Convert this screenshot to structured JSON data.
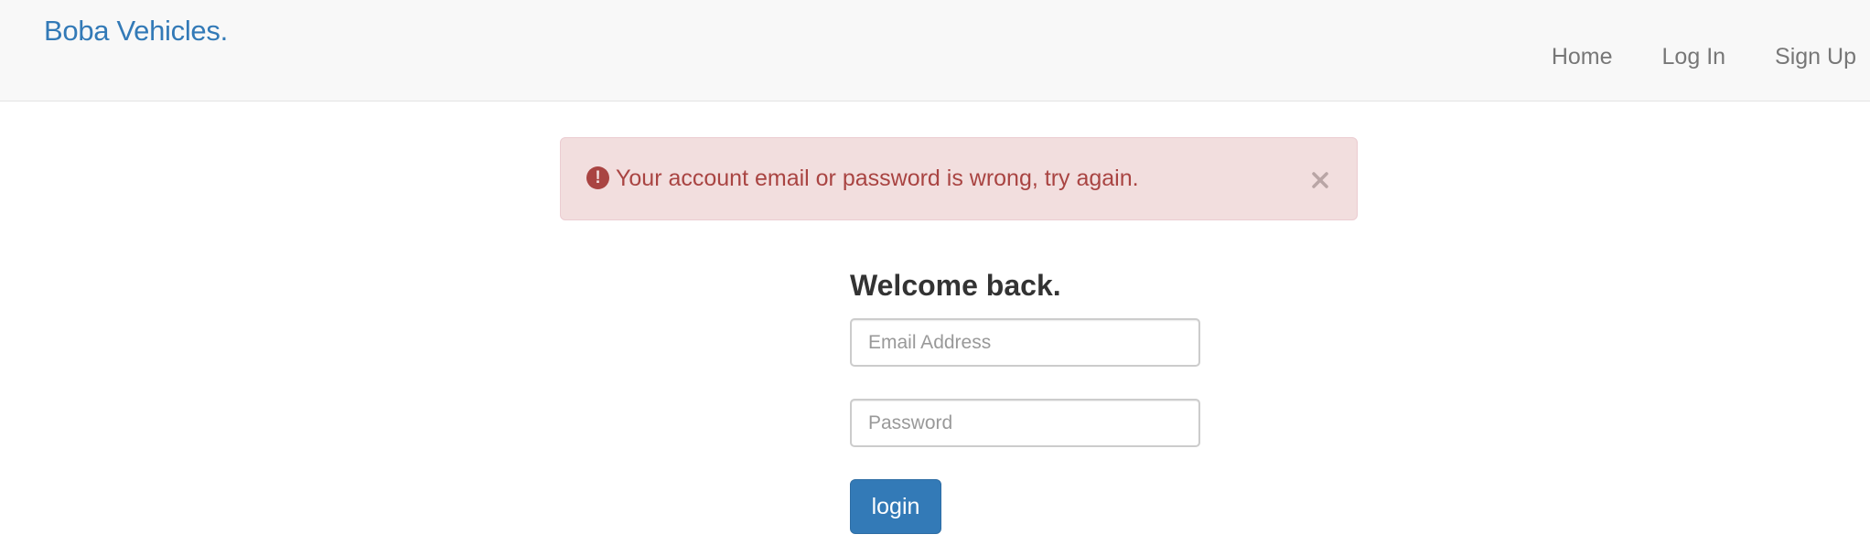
{
  "navbar": {
    "brand": "Boba Vehicles.",
    "links": [
      {
        "label": "Home"
      },
      {
        "label": "Log In"
      },
      {
        "label": "Sign Up"
      }
    ]
  },
  "alert": {
    "icon": "exclamation-circle-icon",
    "message": "Your account email or password is wrong, try again.",
    "close_icon": "close-icon"
  },
  "login_form": {
    "title": "Welcome back.",
    "email_placeholder": "Email Address",
    "email_value": "",
    "password_placeholder": "Password",
    "password_value": "",
    "submit_label": "login"
  },
  "colors": {
    "brand": "#337ab7",
    "alert_text": "#a94442",
    "alert_bg": "#f2dede",
    "button_bg": "#337ab7"
  }
}
